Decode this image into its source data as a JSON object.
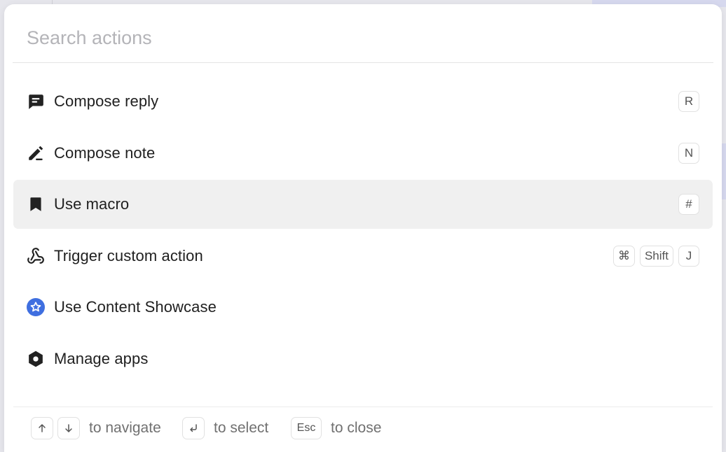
{
  "search": {
    "placeholder": "Search actions",
    "value": ""
  },
  "actions": [
    {
      "label": "Compose reply",
      "icon": "chat-bubble-icon",
      "keys": [
        "R"
      ]
    },
    {
      "label": "Compose note",
      "icon": "pen-icon",
      "keys": [
        "N"
      ]
    },
    {
      "label": "Use macro",
      "icon": "bookmark-icon",
      "keys": [
        "#"
      ],
      "selected": true
    },
    {
      "label": "Trigger custom action",
      "icon": "webhook-icon",
      "keys": [
        "⌘",
        "Shift",
        "J"
      ]
    },
    {
      "label": "Use Content Showcase",
      "icon": "star-badge-icon",
      "keys": []
    },
    {
      "label": "Manage apps",
      "icon": "hexagon-nut-icon",
      "keys": []
    }
  ],
  "footer": {
    "navigate_label": "to navigate",
    "select_label": "to select",
    "close_key": "Esc",
    "close_label": "to close"
  },
  "colors": {
    "selected_row": "#f0f0f0",
    "content_showcase_icon": "#3f6fe0",
    "icon_dark": "#222222"
  }
}
